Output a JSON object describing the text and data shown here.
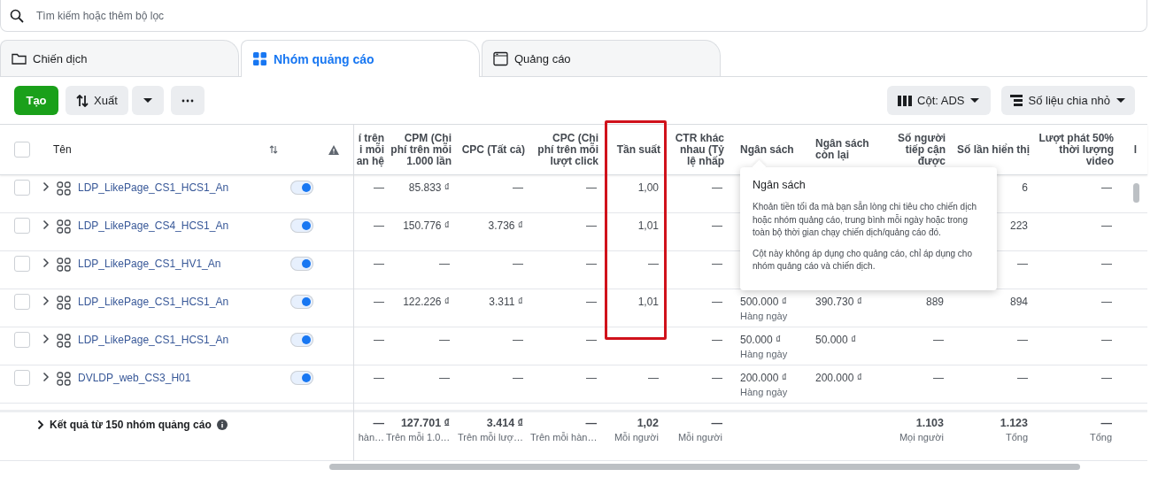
{
  "search": {
    "placeholder": "Tìm kiếm hoặc thêm bộ lọc"
  },
  "tabs": [
    {
      "label": "Chiến dịch",
      "kind": "campaign",
      "selected": false
    },
    {
      "label": "Nhóm quảng cáo",
      "kind": "adset",
      "selected": true
    },
    {
      "label": "Quảng cáo",
      "kind": "ad",
      "selected": false
    }
  ],
  "toolbar": {
    "create": "Tạo",
    "export": "Xuất",
    "columns": "Cột: ADS",
    "breakdown": "Số liệu chia nhỏ"
  },
  "table": {
    "select_all_checked": false,
    "name_header": "Tên",
    "columns": [
      {
        "label": "í trên i mỗi an hệ",
        "kind": "metric",
        "highlighted": false
      },
      {
        "label": "CPM (Chi phí trên mỗi 1.000 lần",
        "kind": "metric",
        "highlighted": false
      },
      {
        "label": "CPC (Tất cả)",
        "kind": "metric",
        "highlighted": false
      },
      {
        "label": "CPC (Chi phí trên mỗi lượt click",
        "kind": "metric",
        "highlighted": false
      },
      {
        "label": "Tần suất",
        "kind": "metric",
        "highlighted": true
      },
      {
        "label": "CTR khác nhau (Tỷ lệ nhấp",
        "kind": "metric",
        "highlighted": false
      },
      {
        "label": "Ngân sách",
        "kind": "budget",
        "highlighted": false,
        "tooltip": {
          "title": "Ngân sách",
          "paragraphs": [
            "Khoản tiền tối đa mà bạn sẵn lòng chi tiêu cho chiến dịch hoặc nhóm quảng cáo, trung bình mỗi ngày hoặc trong toàn bộ thời gian chạy chiến dịch/quảng cáo đó.",
            "Cột này không áp dụng cho quảng cáo, chỉ áp dụng cho nhóm quảng cáo và chiến dịch."
          ]
        }
      },
      {
        "label": "Ngân sách còn lại",
        "kind": "budget",
        "highlighted": false
      },
      {
        "label": "Số người tiếp cận được",
        "kind": "metric",
        "highlighted": false
      },
      {
        "label": "Số lần hiển thị",
        "kind": "metric",
        "highlighted": false
      },
      {
        "label": "Lượt phát 50% thời lượng video",
        "kind": "metric",
        "highlighted": false
      },
      {
        "label": "l",
        "kind": "metric",
        "highlighted": false
      }
    ],
    "rows": [
      {
        "name": "LDP_LikePage_CS1_HCS1_An",
        "selected": false,
        "on": true,
        "cells": [
          "—",
          "85.833 ₫",
          "—",
          "—",
          "1,00",
          "—",
          null,
          null,
          null,
          "6",
          "—",
          null
        ]
      },
      {
        "name": "LDP_LikePage_CS4_HCS1_An",
        "selected": false,
        "on": true,
        "cells": [
          "—",
          "150.776 ₫",
          "3.736 ₫",
          "—",
          "1,01",
          "—",
          null,
          null,
          null,
          "223",
          "—",
          null
        ]
      },
      {
        "name": "LDP_LikePage_CS1_HV1_An",
        "selected": false,
        "on": true,
        "cells": [
          "—",
          "—",
          "—",
          "—",
          "—",
          "—",
          null,
          null,
          null,
          "—",
          "—",
          null
        ]
      },
      {
        "name": "LDP_LikePage_CS1_HCS1_An",
        "selected": false,
        "on": true,
        "cells": [
          "—",
          "122.226 ₫",
          "3.311 ₫",
          "—",
          "1,01",
          "—",
          {
            "value": "500.000 ₫",
            "note": "Hàng ngày"
          },
          "390.730 ₫",
          "889",
          "894",
          "—",
          null
        ]
      },
      {
        "name": "LDP_LikePage_CS1_HCS1_An",
        "selected": false,
        "on": true,
        "cells": [
          "—",
          "—",
          "—",
          "—",
          null,
          "—",
          {
            "value": "50.000 ₫",
            "note": "Hàng ngày"
          },
          "50.000 ₫",
          "—",
          "—",
          "—",
          null
        ]
      },
      {
        "name": "DVLDP_web_CS3_H01",
        "selected": false,
        "on": true,
        "cells": [
          "—",
          "—",
          "—",
          "—",
          "—",
          "—",
          {
            "value": "200.000 ₫",
            "note": "Hàng ngày"
          },
          "200.000 ₫",
          "—",
          "—",
          "—",
          null
        ]
      }
    ],
    "summary": {
      "label": "Kết quả từ 150 nhóm quảng cáo",
      "cells": [
        {
          "value": "—",
          "note": "hàn…"
        },
        {
          "value": "127.701 ₫",
          "note": "Trên mỗi 1.0…"
        },
        {
          "value": "3.414 ₫",
          "note": "Trên mỗi lượ…"
        },
        {
          "value": "—",
          "note": "Trên mỗi hàn…"
        },
        {
          "value": "1,02",
          "note": "Mỗi người"
        },
        {
          "value": "—",
          "note": "Mỗi người"
        },
        null,
        null,
        {
          "value": "1.103",
          "note": "Mọi người"
        },
        {
          "value": "1.123",
          "note": "Tổng"
        },
        {
          "value": "—",
          "note": "Tổng"
        },
        null
      ]
    }
  }
}
